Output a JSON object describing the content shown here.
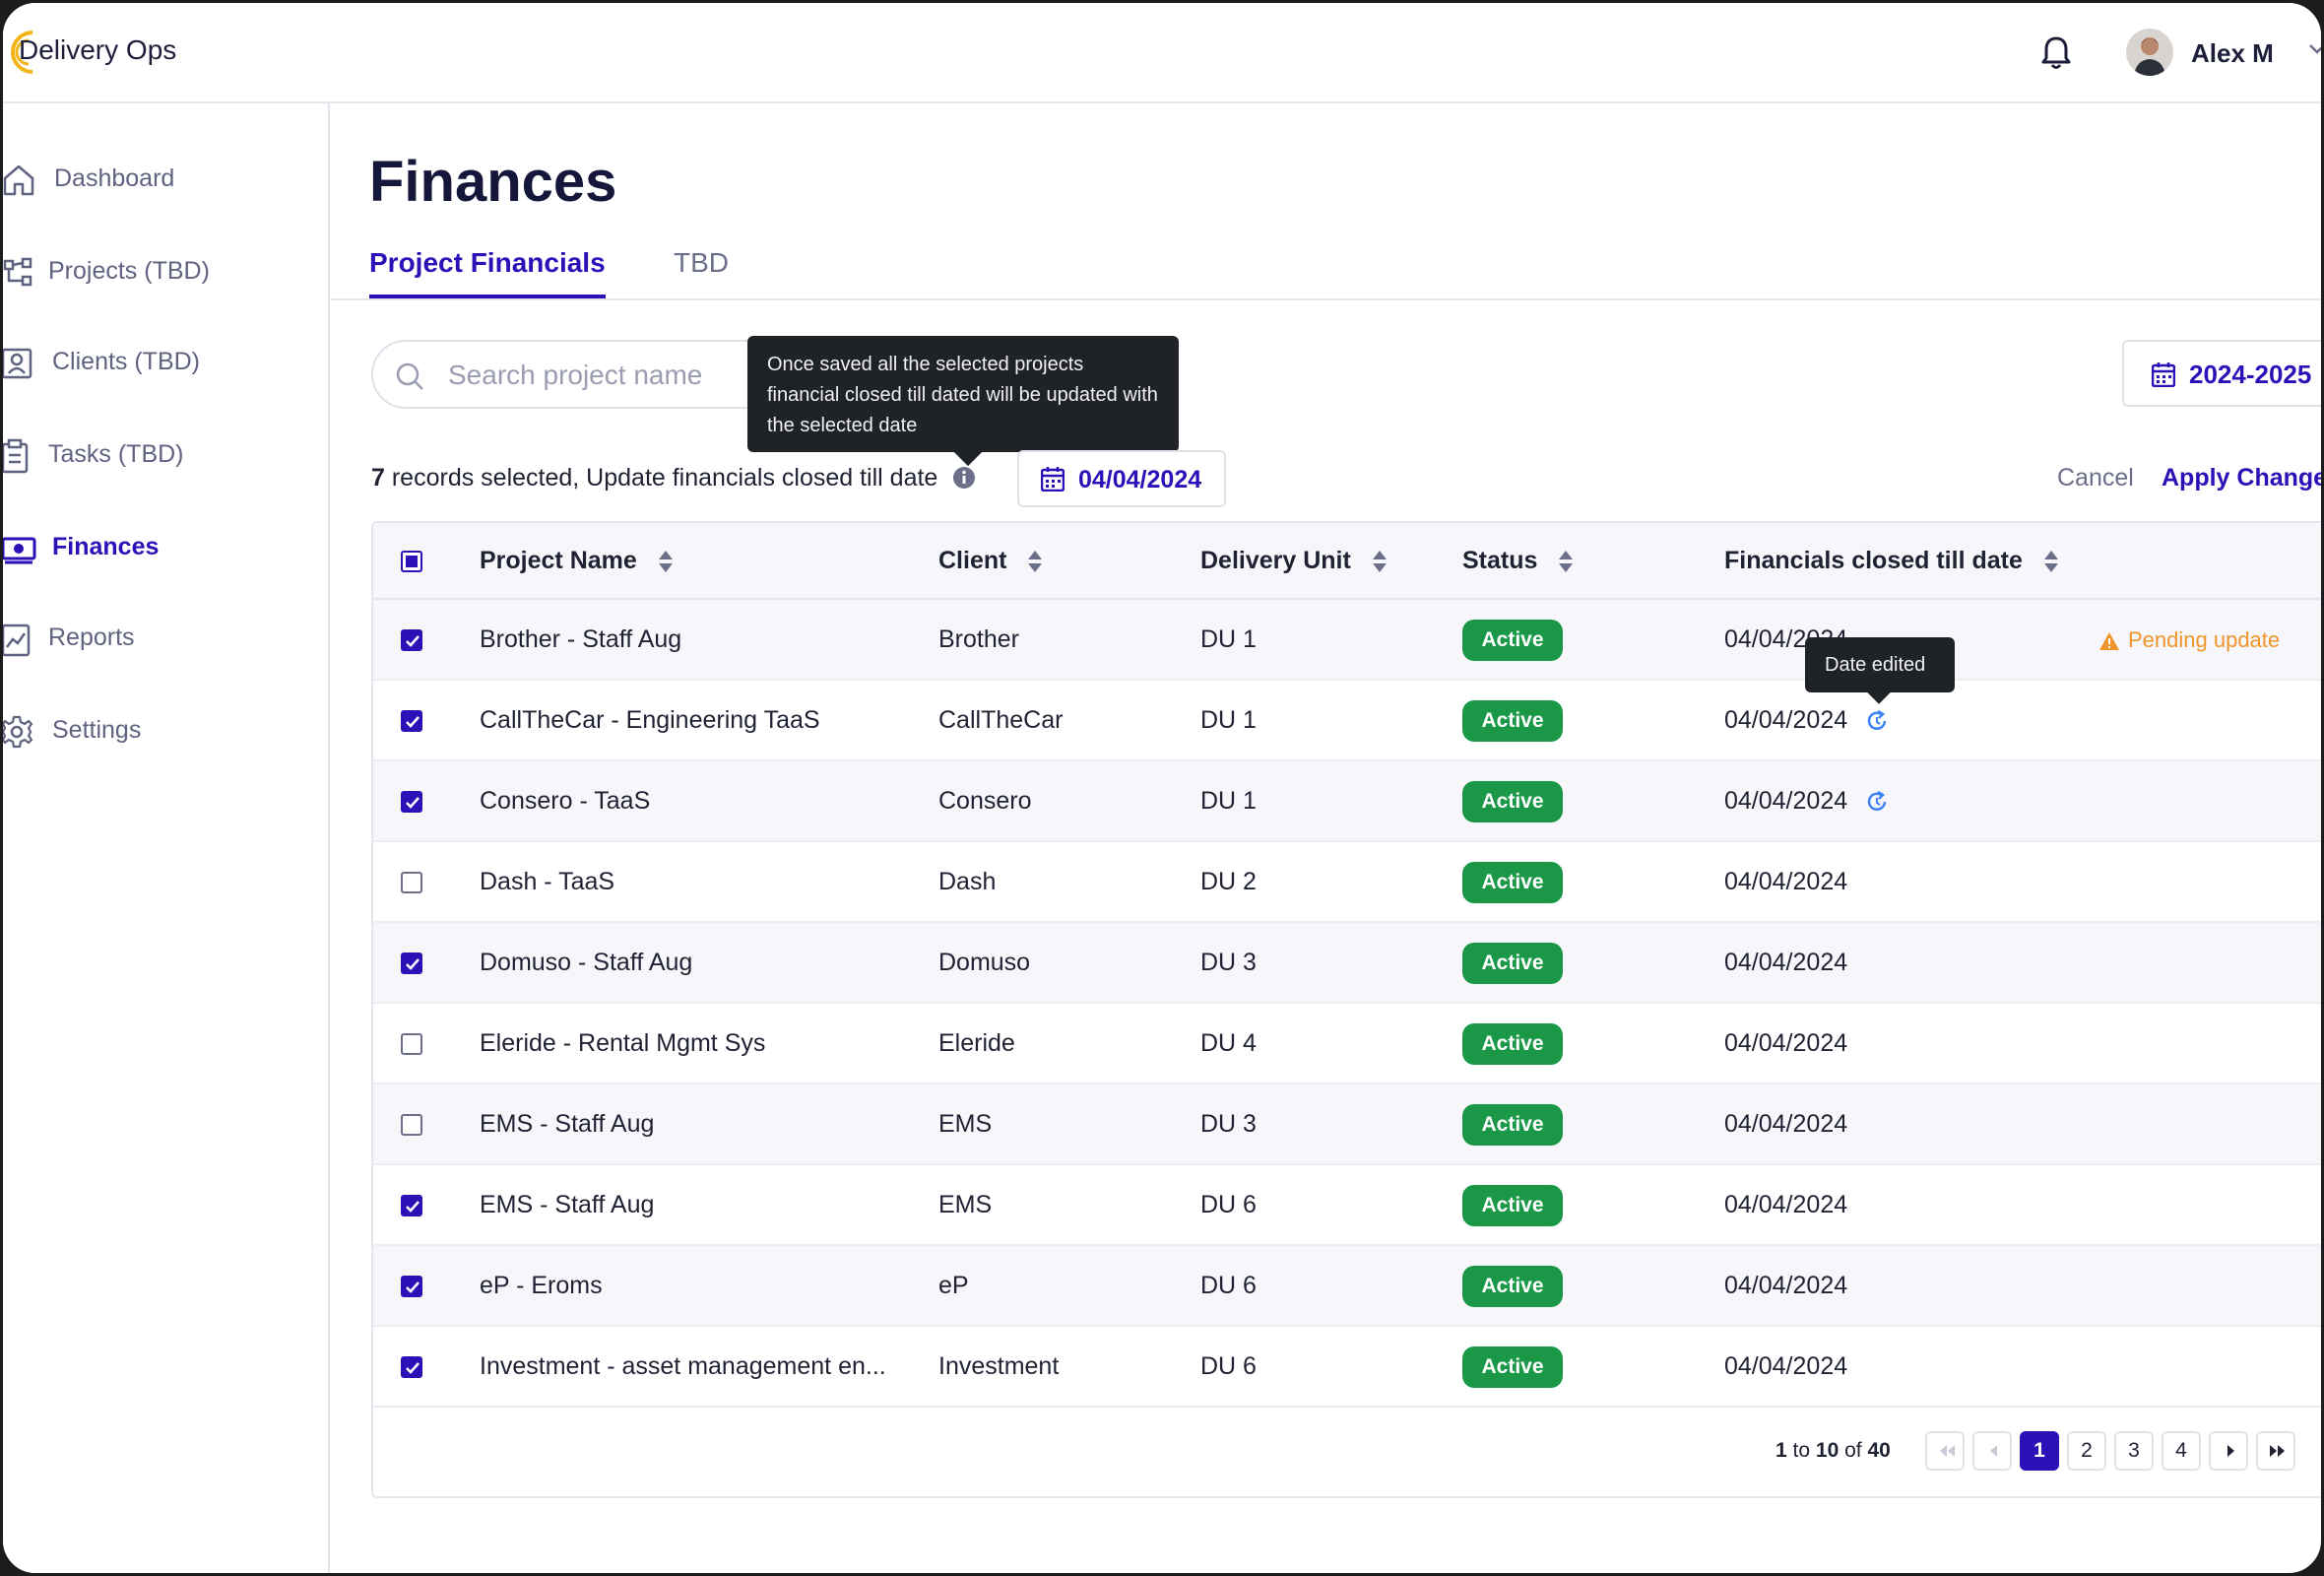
{
  "app": {
    "name": "Delivery Ops"
  },
  "user": {
    "name": "Alex M"
  },
  "sidebar": {
    "items": [
      {
        "label": "Dashboard",
        "icon": "home-icon",
        "active": false
      },
      {
        "label": "Projects (TBD)",
        "icon": "project-tree-icon",
        "active": false
      },
      {
        "label": "Clients (TBD)",
        "icon": "client-card-icon",
        "active": false
      },
      {
        "label": "Tasks (TBD)",
        "icon": "clipboard-icon",
        "active": false
      },
      {
        "label": "Finances",
        "icon": "money-icon",
        "active": true
      },
      {
        "label": "Reports",
        "icon": "chart-report-icon",
        "active": false
      },
      {
        "label": "Settings",
        "icon": "gear-icon",
        "active": false
      }
    ]
  },
  "page": {
    "title": "Finances"
  },
  "tabs": [
    {
      "label": "Project Financials",
      "active": true
    },
    {
      "label": "TBD",
      "active": false
    }
  ],
  "search": {
    "placeholder": "Search project name",
    "value": ""
  },
  "fiscal_year": {
    "label": "2024-2025"
  },
  "bulk": {
    "selected_count": "7",
    "message": "records selected, Update financials closed till date",
    "date": "04/04/2024",
    "cancel_label": "Cancel",
    "apply_label": "Apply Changes"
  },
  "tooltips": {
    "info": "Once saved all the selected projects financial closed till dated will be updated with the selected date",
    "date_edited": "Date edited"
  },
  "table": {
    "headers": {
      "project": "Project Name",
      "client": "Client",
      "unit": "Delivery Unit",
      "status": "Status",
      "closed_date": "Financials closed till date"
    },
    "rows": [
      {
        "checked": true,
        "project": "Brother - Staff Aug",
        "client": "Brother",
        "unit": "DU 1",
        "status": "Active",
        "date": "04/04/2024",
        "edited": false,
        "pending": "Pending update"
      },
      {
        "checked": true,
        "project": "CallTheCar - Engineering TaaS",
        "client": "CallTheCar",
        "unit": "DU 1",
        "status": "Active",
        "date": "04/04/2024",
        "edited": true,
        "pending": ""
      },
      {
        "checked": true,
        "project": "Consero - TaaS",
        "client": "Consero",
        "unit": "DU 1",
        "status": "Active",
        "date": "04/04/2024",
        "edited": true,
        "pending": ""
      },
      {
        "checked": false,
        "project": "Dash - TaaS",
        "client": "Dash",
        "unit": "DU 2",
        "status": "Active",
        "date": "04/04/2024",
        "edited": false,
        "pending": ""
      },
      {
        "checked": true,
        "project": "Domuso - Staff Aug",
        "client": "Domuso",
        "unit": "DU 3",
        "status": "Active",
        "date": "04/04/2024",
        "edited": false,
        "pending": ""
      },
      {
        "checked": false,
        "project": "Eleride - Rental Mgmt Sys",
        "client": "Eleride",
        "unit": "DU 4",
        "status": "Active",
        "date": "04/04/2024",
        "edited": false,
        "pending": ""
      },
      {
        "checked": false,
        "project": "EMS - Staff Aug",
        "client": "EMS",
        "unit": "DU 3",
        "status": "Active",
        "date": "04/04/2024",
        "edited": false,
        "pending": ""
      },
      {
        "checked": true,
        "project": "EMS - Staff Aug",
        "client": "EMS",
        "unit": "DU 6",
        "status": "Active",
        "date": "04/04/2024",
        "edited": false,
        "pending": ""
      },
      {
        "checked": true,
        "project": "eP - Eroms",
        "client": "eP",
        "unit": "DU 6",
        "status": "Active",
        "date": "04/04/2024",
        "edited": false,
        "pending": ""
      },
      {
        "checked": true,
        "project": "Investment - asset management en...",
        "client": "Investment",
        "unit": "DU 6",
        "status": "Active",
        "date": "04/04/2024",
        "edited": false,
        "pending": ""
      }
    ]
  },
  "pagination": {
    "from": "1",
    "to_word": "to",
    "to": "10",
    "of_word": "of",
    "total": "40",
    "pages": [
      "1",
      "2",
      "3",
      "4"
    ],
    "current": "1"
  },
  "colors": {
    "accent": "#2a11b8",
    "active_badge": "#1a9847",
    "pending": "#f0952b",
    "edited_icon": "#3b82f6"
  }
}
